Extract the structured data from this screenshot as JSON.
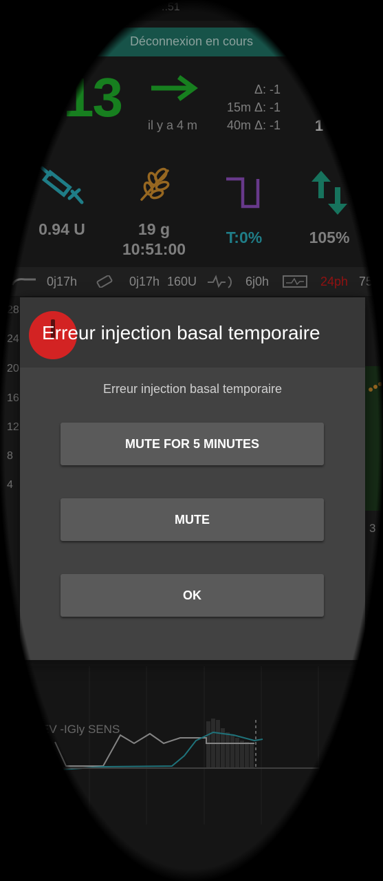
{
  "status_bar": {
    "time_fragment": "..51"
  },
  "banner": {
    "text": "Déconnexion en cours"
  },
  "glucose": {
    "value_partial": "13",
    "ago": "il y a 4 m",
    "deltas": [
      "Δ: -1",
      "15m Δ: -1",
      "40m Δ: -1"
    ],
    "right_partial": "1",
    "color": "#1faa2a"
  },
  "tiles": {
    "insulin": {
      "line1": "0.94 U"
    },
    "carbs": {
      "line1": "19 g",
      "line2": "10:51:00"
    },
    "temp_basal": {
      "line1": "T:0%",
      "color": "#2aa7b4"
    },
    "profile": {
      "line1": "105%"
    }
  },
  "info_strip": {
    "cannula_age": "0j17h",
    "reservoir_age": "0j17h",
    "reservoir_level": "160U",
    "sensor_age": "6j0h",
    "battery_age": "24ph",
    "battery_level": "75"
  },
  "chart": {
    "y_labels": [
      "28",
      "24",
      "20",
      "16",
      "12",
      "8",
      "4"
    ],
    "right_digit": "3"
  },
  "lower_chart": {
    "label": "EV -IGly SENS"
  },
  "dialog": {
    "title": "Erreur injection basal temporaire",
    "message": "Erreur injection basal temporaire",
    "buttons": {
      "mute5": "MUTE FOR 5 MINUTES",
      "mute": "MUTE",
      "ok": "OK"
    },
    "icon": "alert-icon",
    "icon_color": "#d32323"
  }
}
